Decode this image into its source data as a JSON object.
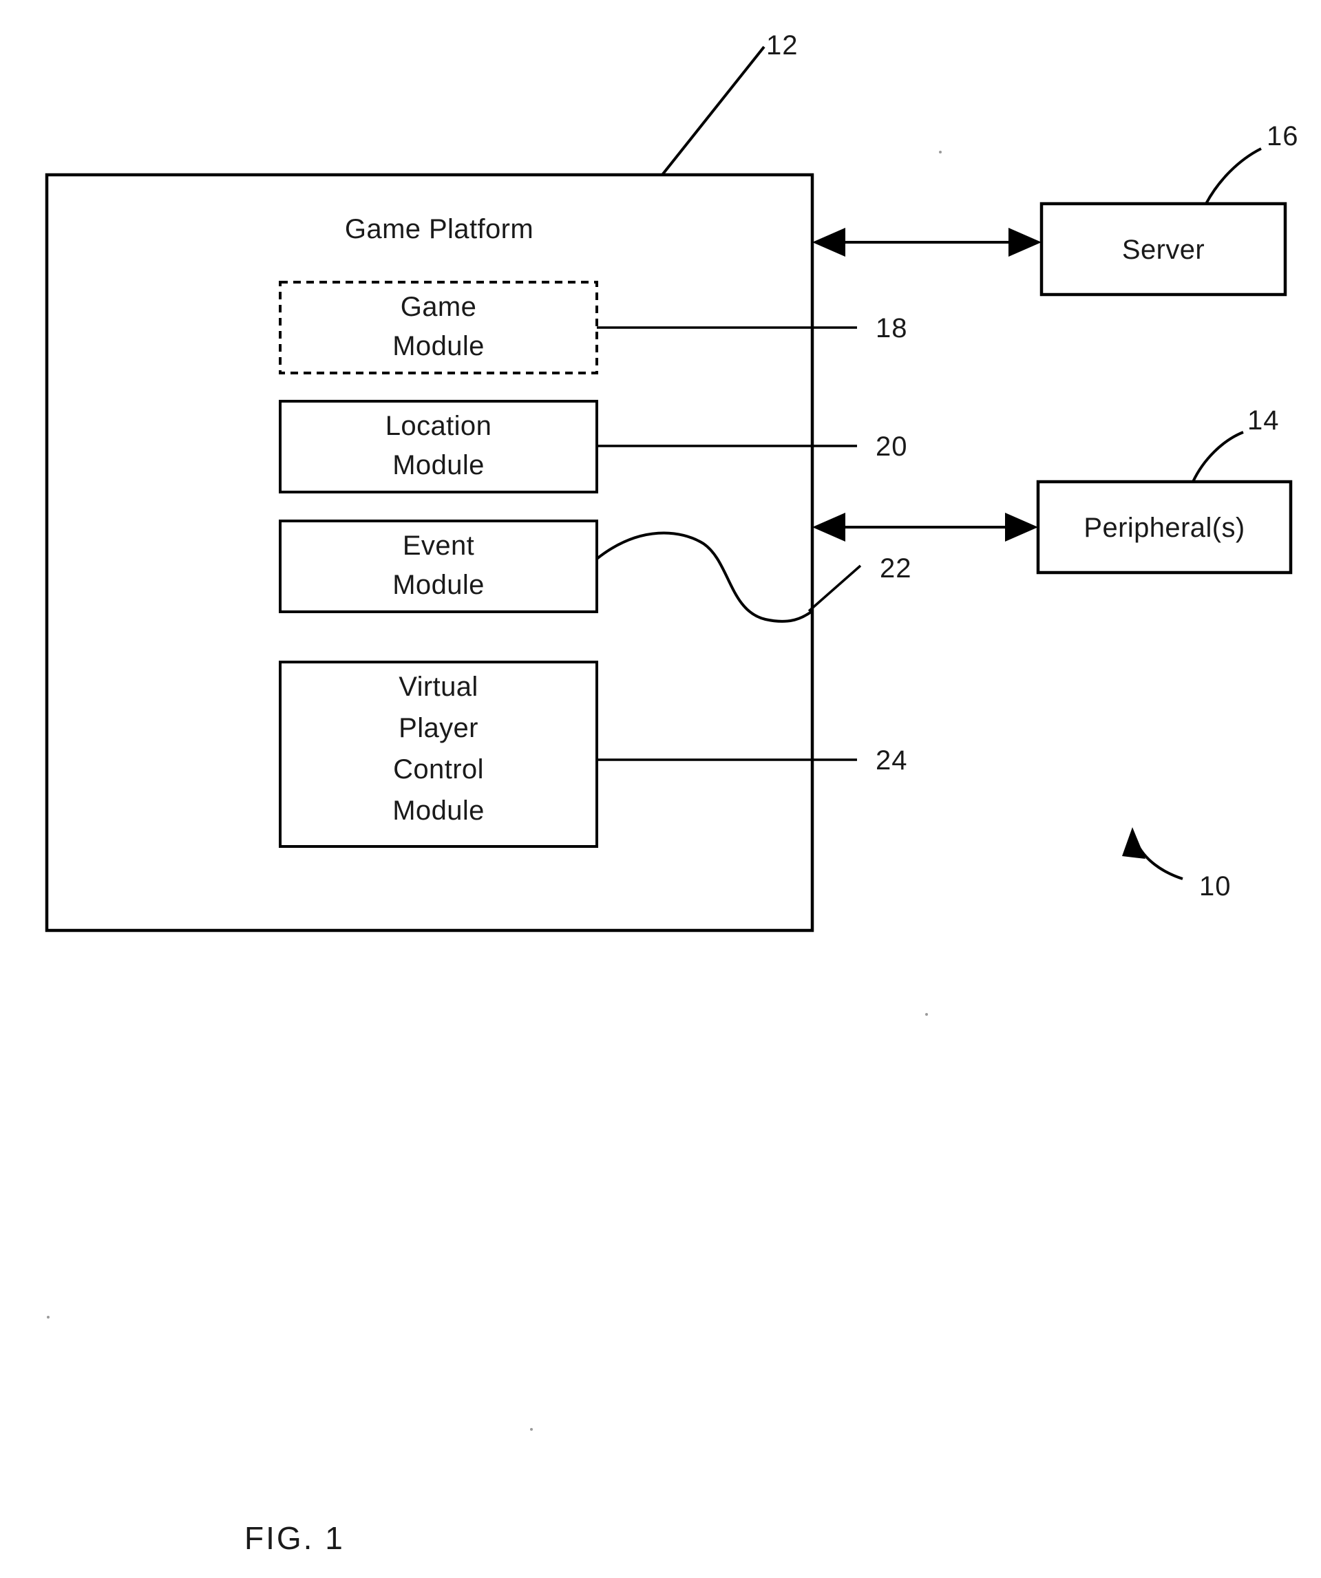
{
  "figure": {
    "caption": "FIG. 1",
    "system_ref": "10"
  },
  "platform": {
    "title": "Game Platform",
    "ref": "12",
    "modules": [
      {
        "id": "game",
        "label_lines": [
          "Game",
          "Module"
        ],
        "ref": "18",
        "border": "dashed"
      },
      {
        "id": "location",
        "label_lines": [
          "Location",
          "Module"
        ],
        "ref": "20",
        "border": "solid"
      },
      {
        "id": "event",
        "label_lines": [
          "Event",
          "Module"
        ],
        "ref": "22",
        "border": "solid"
      },
      {
        "id": "vpc",
        "label_lines": [
          "Virtual",
          "Player",
          "Control",
          "Module"
        ],
        "ref": "24",
        "border": "solid"
      }
    ]
  },
  "external": [
    {
      "id": "server",
      "label": "Server",
      "ref": "16"
    },
    {
      "id": "peripherals",
      "label": "Peripheral(s)",
      "ref": "14"
    }
  ],
  "labels": {
    "game_platform": "Game Platform",
    "game_module_l1": "Game",
    "game_module_l2": "Module",
    "location_module_l1": "Location",
    "location_module_l2": "Module",
    "event_module_l1": "Event",
    "event_module_l2": "Module",
    "vpc_l1": "Virtual",
    "vpc_l2": "Player",
    "vpc_l3": "Control",
    "vpc_l4": "Module",
    "server": "Server",
    "peripherals": "Peripheral(s)",
    "ref_12": "12",
    "ref_16": "16",
    "ref_14": "14",
    "ref_18": "18",
    "ref_20": "20",
    "ref_22": "22",
    "ref_24": "24",
    "ref_10": "10",
    "fig": "FIG. 1"
  },
  "colors": {
    "ink": "#000000",
    "paper": "#ffffff"
  }
}
